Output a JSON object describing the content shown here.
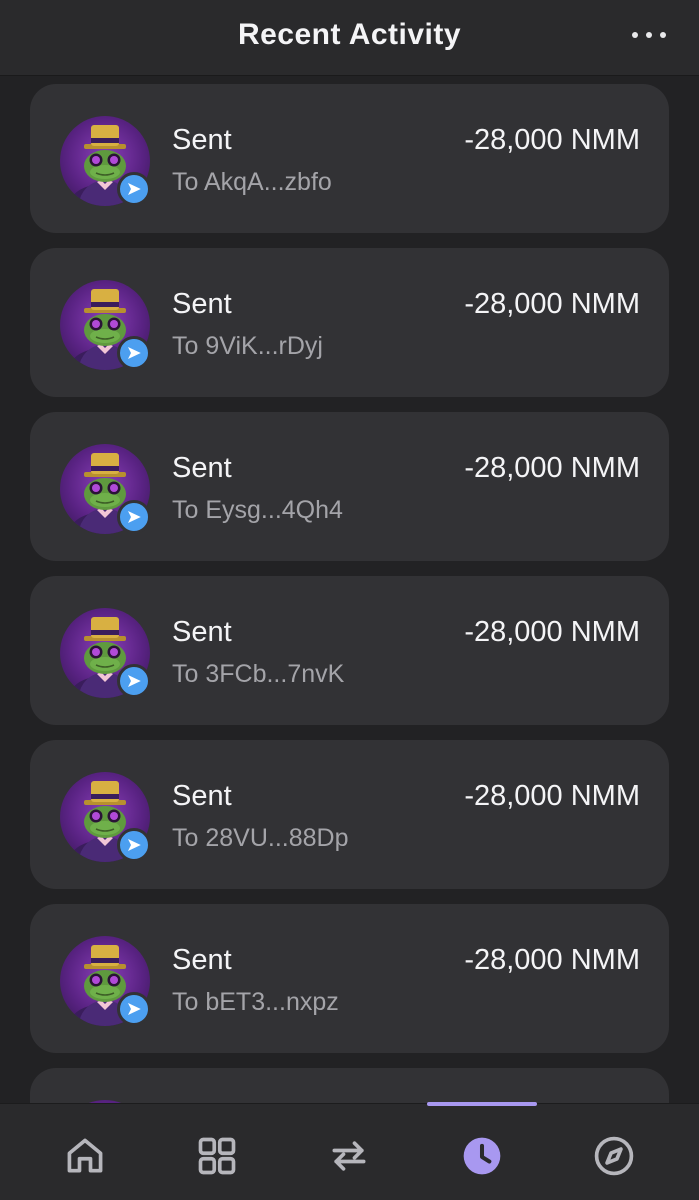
{
  "header": {
    "title": "Recent Activity",
    "more_icon": "more-horizontal-icon"
  },
  "transactions": [
    {
      "title": "Sent",
      "recipient": "To AkqA...zbfo",
      "amount": "-28,000 NMM"
    },
    {
      "title": "Sent",
      "recipient": "To 9ViK...rDyj",
      "amount": "-28,000 NMM"
    },
    {
      "title": "Sent",
      "recipient": "To Eysg...4Qh4",
      "amount": "-28,000 NMM"
    },
    {
      "title": "Sent",
      "recipient": "To 3FCb...7nvK",
      "amount": "-28,000 NMM"
    },
    {
      "title": "Sent",
      "recipient": "To 28VU...88Dp",
      "amount": "-28,000 NMM"
    },
    {
      "title": "Sent",
      "recipient": "To bET3...nxpz",
      "amount": "-28,000 NMM"
    }
  ],
  "nav": {
    "items": [
      "home-icon",
      "grid-icon",
      "swap-icon",
      "history-icon",
      "explore-icon"
    ],
    "active": "history-icon"
  },
  "colors": {
    "background": "#222224",
    "card": "#323235",
    "accent": "#a898f0",
    "send_badge": "#4c9ff0",
    "nav_icon": "#b6b6bc"
  }
}
